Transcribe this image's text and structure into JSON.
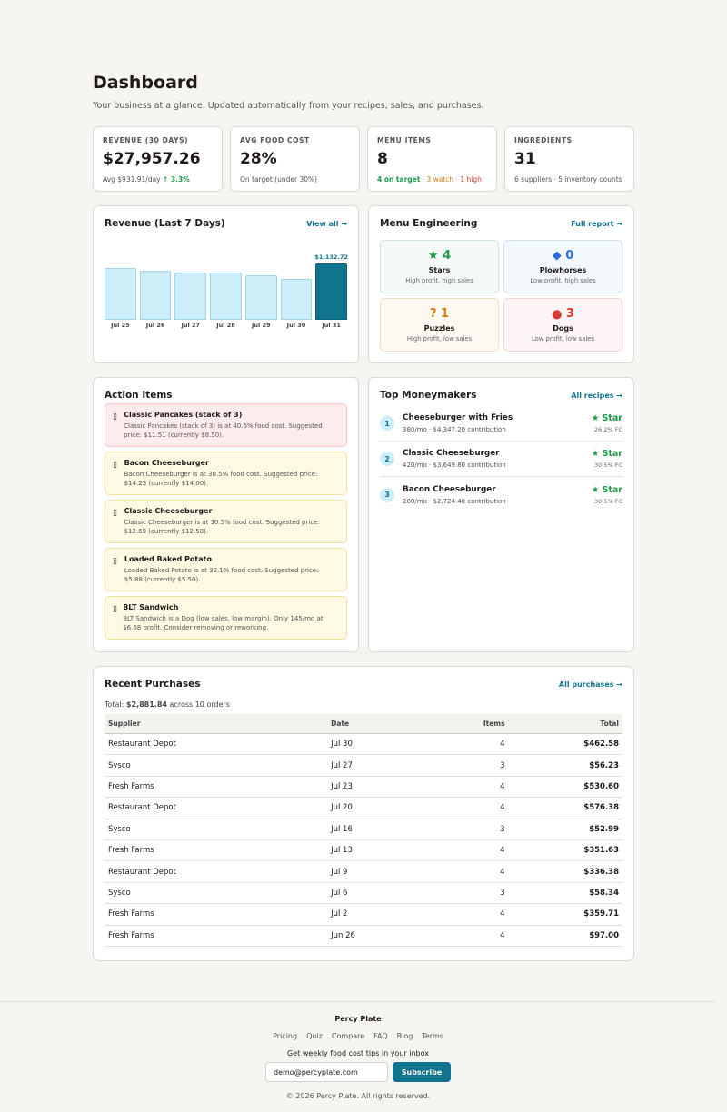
{
  "header": {
    "title": "Dashboard",
    "subtitle": "Your business at a glance. Updated automatically from your recipes, sales, and purchases."
  },
  "stats": [
    {
      "label": "REVENUE (30 DAYS)",
      "value": "$27,957.26",
      "sub": "Avg $931.91/day",
      "delta": "↑ 3.3%"
    },
    {
      "label": "AVG FOOD COST",
      "value": "28%",
      "sub": "On target (under 30%)"
    },
    {
      "label": "MENU ITEMS",
      "value": "8",
      "on_target": "4 on target",
      "watch": "3 watch",
      "high": "1 high"
    },
    {
      "label": "INGREDIENTS",
      "value": "31",
      "sub": "6 suppliers · 5 inventory counts"
    }
  ],
  "revenue": {
    "title": "Revenue (Last 7 Days)",
    "link": "View all →",
    "highlight_label": "$1,132.72"
  },
  "chart_data": {
    "type": "bar",
    "categories": [
      "Jul 25",
      "Jul 26",
      "Jul 27",
      "Jul 28",
      "Jul 29",
      "Jul 30",
      "Jul 31"
    ],
    "values": [
      1050,
      980,
      950,
      950,
      890,
      830,
      1132.72
    ],
    "title": "Revenue (Last 7 Days)",
    "ylim": [
      0,
      1132.72
    ],
    "highlight_index": 6
  },
  "menu_engineering": {
    "title": "Menu Engineering",
    "link": "Full report →",
    "cells": [
      {
        "icon": "★",
        "count": "4",
        "name": "Stars",
        "desc": "High profit, high sales",
        "color": "#1e9a4a"
      },
      {
        "icon": "◆",
        "count": "0",
        "name": "Plowhorses",
        "desc": "Low profit, high sales",
        "color": "#2b6cd9"
      },
      {
        "icon": "?",
        "count": "1",
        "name": "Puzzles",
        "desc": "High profit, low sales",
        "color": "#d4811a"
      },
      {
        "icon": "⬤",
        "count": "3",
        "name": "Dogs",
        "desc": "Low profit, low sales",
        "color": "#d63a2f"
      }
    ]
  },
  "actions": {
    "title": "Action Items",
    "items": [
      {
        "title": "Classic Pancakes (stack of 3)",
        "desc": "Classic Pancakes (stack of 3) is at 40.6% food cost. Suggested price: $11.51 (currently $8.50).",
        "level": "red"
      },
      {
        "title": "Bacon Cheeseburger",
        "desc": "Bacon Cheeseburger is at 30.5% food cost. Suggested price: $14.23 (currently $14.00).",
        "level": "yellow"
      },
      {
        "title": "Classic Cheeseburger",
        "desc": "Classic Cheeseburger is at 30.5% food cost. Suggested price: $12.69 (currently $12.50).",
        "level": "yellow"
      },
      {
        "title": "Loaded Baked Potato",
        "desc": "Loaded Baked Potato is at 32.1% food cost. Suggested price: $5.88 (currently $5.50).",
        "level": "yellow"
      },
      {
        "title": "BLT Sandwich",
        "desc": "BLT Sandwich is a Dog (low sales, low margin). Only 145/mo at $6.68 profit. Consider removing or reworking.",
        "level": "yellow"
      }
    ]
  },
  "moneymakers": {
    "title": "Top Moneymakers",
    "link": "All recipes →",
    "items": [
      {
        "rank": "1",
        "name": "Cheeseburger with Fries",
        "sub": "380/mo · $4,347.20 contribution",
        "badge": "★ Star",
        "fc": "26.2% FC"
      },
      {
        "rank": "2",
        "name": "Classic Cheeseburger",
        "sub": "420/mo · $3,649.80 contribution",
        "badge": "★ Star",
        "fc": "30.5% FC"
      },
      {
        "rank": "3",
        "name": "Bacon Cheeseburger",
        "sub": "280/mo · $2,724.40 contribution",
        "badge": "★ Star",
        "fc": "30.5% FC"
      }
    ]
  },
  "purchases": {
    "title": "Recent Purchases",
    "link": "All purchases →",
    "total_prefix": "Total:",
    "total_value": "$2,881.84",
    "total_suffix": "across 10 orders",
    "columns": [
      "Supplier",
      "Date",
      "Items",
      "Total"
    ],
    "rows": [
      [
        "Restaurant Depot",
        "Jul 30",
        "4",
        "$462.58"
      ],
      [
        "Sysco",
        "Jul 27",
        "3",
        "$56.23"
      ],
      [
        "Fresh Farms",
        "Jul 23",
        "4",
        "$530.60"
      ],
      [
        "Restaurant Depot",
        "Jul 20",
        "4",
        "$576.38"
      ],
      [
        "Sysco",
        "Jul 16",
        "3",
        "$52.99"
      ],
      [
        "Fresh Farms",
        "Jul 13",
        "4",
        "$351.63"
      ],
      [
        "Restaurant Depot",
        "Jul 9",
        "4",
        "$336.38"
      ],
      [
        "Sysco",
        "Jul 6",
        "3",
        "$58.34"
      ],
      [
        "Fresh Farms",
        "Jul 2",
        "4",
        "$359.71"
      ],
      [
        "Fresh Farms",
        "Jun 26",
        "4",
        "$97.00"
      ]
    ]
  },
  "footer": {
    "brand": "Percy Plate",
    "links": [
      "Pricing",
      "Quiz",
      "Compare",
      "FAQ",
      "Blog",
      "Terms"
    ],
    "newsletter": "Get weekly food cost tips in your inbox",
    "email_value": "demo@percyplate.com",
    "subscribe": "Subscribe",
    "copyright": "© 2026 Percy Plate. All rights reserved."
  }
}
